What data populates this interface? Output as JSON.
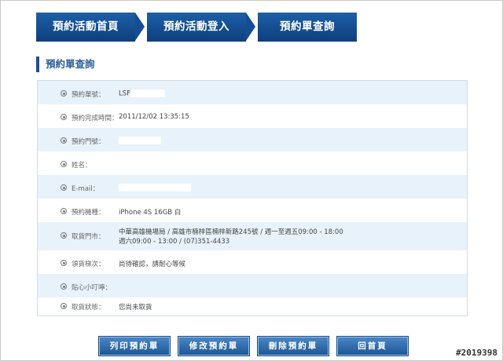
{
  "nav": {
    "tabs": [
      "預約活動首頁",
      "預約活動登入",
      "預約單查詢"
    ]
  },
  "section_title": "預約單查詢",
  "details": [
    {
      "label": "預約單號：",
      "value": "LSF"
    },
    {
      "label": "預約完成時間：",
      "value": "2011/12/02 13:35:15"
    },
    {
      "label": "預約門號：",
      "value": ""
    },
    {
      "label": "姓名：",
      "value": ""
    },
    {
      "label": "E-mail：",
      "value": ""
    },
    {
      "label": "預約機種：",
      "value": "iPhone 4S 16GB 白"
    },
    {
      "label": "取貨門市：",
      "value": "中華高雄機場局 / 高雄市楠梓區楠梓新路245號 / 週一至週五09:00 - 18:00",
      "value2": "週六09:00 - 13:00 / (07)351-4433"
    },
    {
      "label": "領貨梯次：",
      "value": "尚待確認，請耐心等候"
    },
    {
      "label": "貼心小叮嚀：",
      "value": ""
    },
    {
      "label": "取貨狀態：",
      "value": "您尚未取貨"
    }
  ],
  "buttons": {
    "print": "列印預約單",
    "edit": "修改預約單",
    "delete": "刪除預約單",
    "home": "回首頁"
  },
  "watermark": "#2019398",
  "colors": {
    "tab_bg": "#1a4f95",
    "row_shade": "#e8f2fb",
    "section_accent": "#2a5d9c"
  }
}
